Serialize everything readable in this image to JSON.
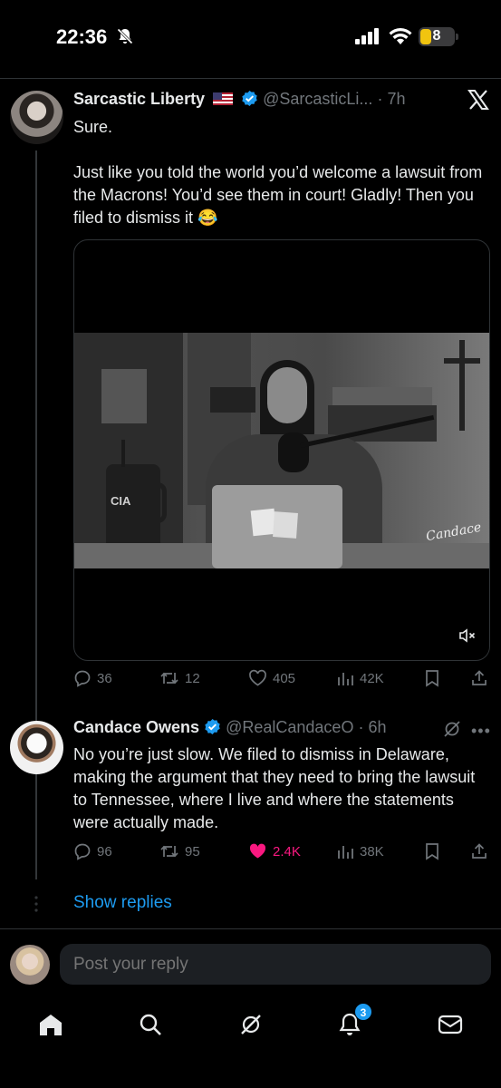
{
  "status_bar": {
    "time": "22:36",
    "battery": "8"
  },
  "tweets": [
    {
      "name": "Sarcastic Liberty",
      "handle": "@SarcasticLi...",
      "time": "· 7h",
      "text": [
        "Sure.",
        "",
        "Just like you told the world you’d welcome a lawsuit from the Macrons! You’d see them in court! Gladly! Then you filed to dismiss it 😂"
      ],
      "video_watermark": "Candace",
      "laptop_sticker": "CIA",
      "stats": {
        "replies": "36",
        "reposts": "12",
        "likes": "405",
        "views": "42K"
      }
    },
    {
      "name": "Candace Owens",
      "handle": "@RealCandaceO",
      "time": "· 6h",
      "text": [
        "No you’re just slow. We filed to dismiss in Delaware, making the argument that they need to bring the lawsuit to Tennessee, where I live and where the statements were actually made."
      ],
      "stats": {
        "replies": "96",
        "reposts": "95",
        "likes": "2.4K",
        "views": "38K"
      }
    }
  ],
  "show_replies": "Show replies",
  "reply_placeholder": "Post your reply",
  "notifications_badge": "3",
  "colors": {
    "accent": "#1d9bf0",
    "like": "#f91880",
    "muted": "#71767b"
  }
}
